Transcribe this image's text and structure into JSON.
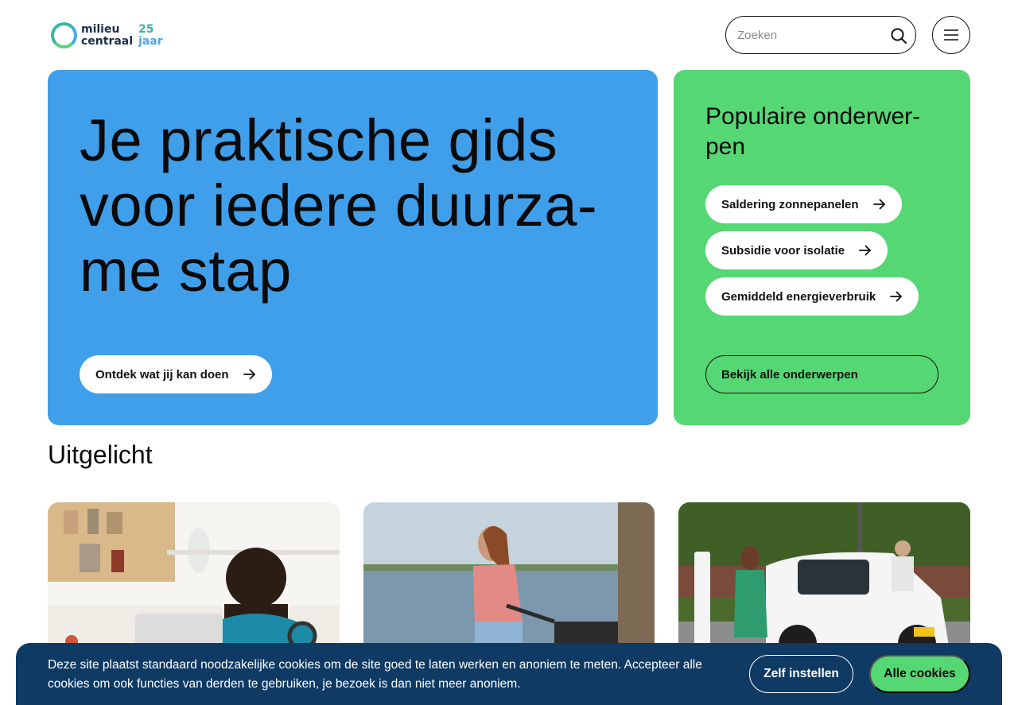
{
  "logo": {
    "line1": "milieu",
    "line2": "centraal",
    "anniv1": "25",
    "anniv2": "jaar"
  },
  "search": {
    "placeholder": "Zoeken"
  },
  "hero": {
    "title": "Je praktische gids voor iedere duurza-me stap",
    "cta": "Ontdek wat jij kan doen"
  },
  "popular": {
    "title": "Populaire onderwer-pen",
    "items": [
      {
        "label": "Saldering zonnepanelen"
      },
      {
        "label": "Subsidie voor isolatie"
      },
      {
        "label": "Gemiddeld energieverbruik"
      }
    ],
    "all_label": "Bekijk alle onderwerpen"
  },
  "featured": {
    "title": "Uitgelicht"
  },
  "cookie": {
    "text": "Deze site plaatst standaard noodzakelijke cookies om de site goed te laten werken en anoniem te meten. Accepteer alle cookies om ook functies van derden te gebruiken, je bezoek is dan niet meer anoniem.",
    "settings_label": "Zelf instellen",
    "accept_label": "Alle cookies"
  },
  "colors": {
    "hero_bg": "#409fea",
    "popular_bg": "#55d773",
    "cookie_bg": "#0e3a63",
    "accent_green": "#55d773"
  },
  "icons": {
    "search": "search-icon",
    "menu": "hamburger-menu-icon",
    "arrow": "arrow-right-icon"
  }
}
